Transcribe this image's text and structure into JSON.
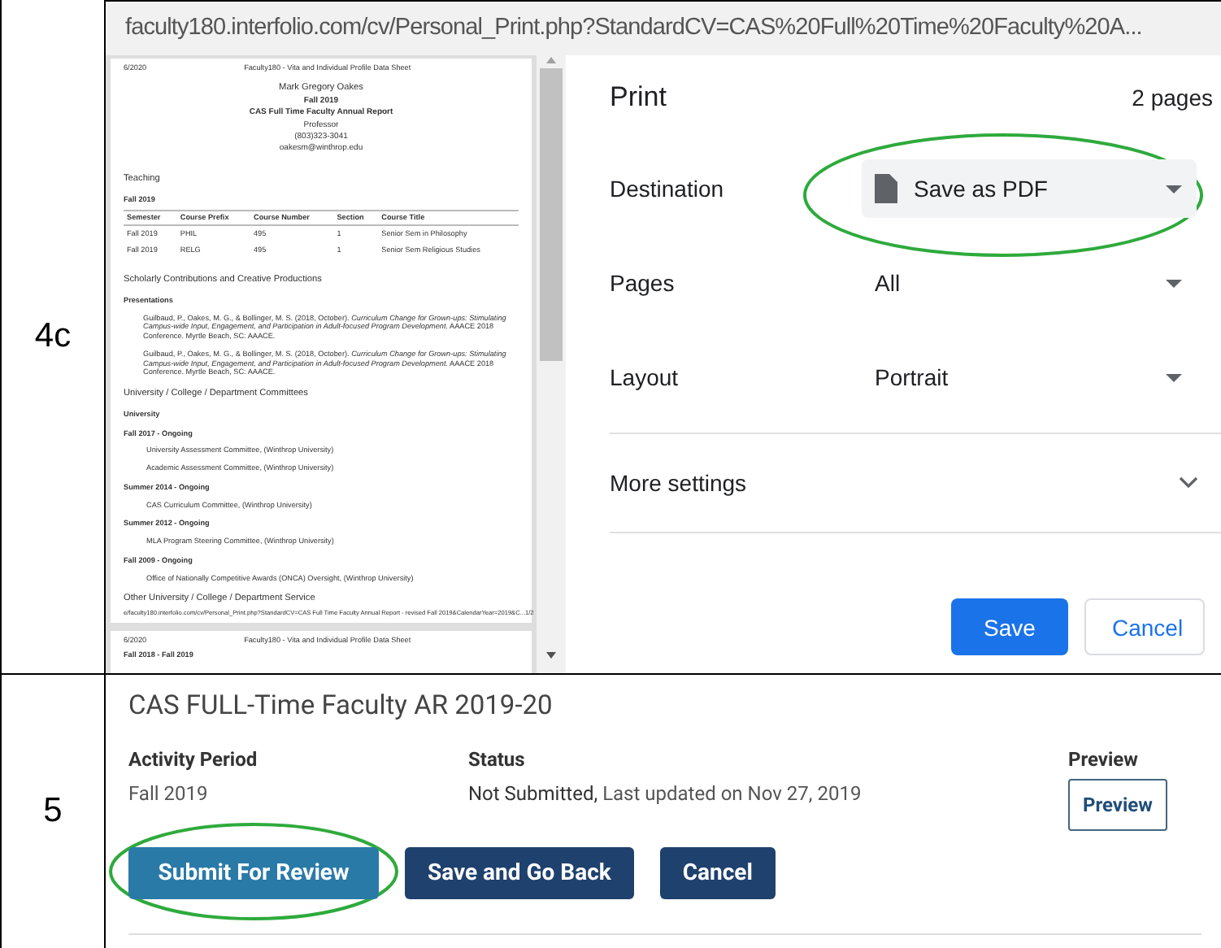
{
  "steps": [
    {
      "label": "4c",
      "kind": "print"
    },
    {
      "label": "5",
      "kind": "review"
    }
  ],
  "print_screen": {
    "url": "faculty180.interfolio.com/cv/Personal_Print.php?StandardCV=CAS%20Full%20Time%20Faculty%20A...",
    "preview": {
      "header_date": "6/2020",
      "header_title": "Faculty180 - Vita and Individual Profile Data Sheet",
      "identity": [
        "Mark Gregory Oakes",
        "Fall 2019",
        "CAS Full Time Faculty Annual Report",
        "Professor",
        "(803)323-3041",
        "oakesm@winthrop.edu"
      ],
      "teaching": {
        "heading": "Teaching",
        "term": "Fall 2019",
        "columns": [
          "Semester",
          "Course Prefix",
          "Course Number",
          "Section",
          "Course Title"
        ],
        "rows": [
          [
            "Fall 2019",
            "PHIL",
            "495",
            "1",
            "Senior Sem in Philosophy"
          ],
          [
            "Fall 2019",
            "RELG",
            "495",
            "1",
            "Senior Sem Religious Studies"
          ]
        ]
      },
      "scholarly": {
        "heading": "Scholarly Contributions and Creative Productions",
        "subheading": "Presentations",
        "citations": [
          "Guilbaud, P., Oakes, M. G., & Bollinger, M. S. (2018, October). *Curriculum Change for Grown-ups: Stimulating Campus-wide Input, Engagement, and Participation in Adult-focused Program Development.* AAACE 2018 Conference. Myrtle Beach, SC: AAACE.",
          "Guilbaud, P., Oakes, M. G., & Bollinger, M. S. (2018, October). *Curriculum Change for Grown-ups: Stimulating Campus-wide Input, Engagement, and Participation in Adult-focused Program Development.* AAACE 2018 Conference. Myrtle Beach, SC: AAACE."
        ]
      },
      "committees": {
        "heading": "University / College / Department Committees",
        "subheading": "University",
        "groups": [
          {
            "period": "Fall 2017 - Ongoing",
            "items": [
              "University Assessment Committee, (Winthrop University)",
              "Academic Assessment Committee, (Winthrop University)"
            ]
          },
          {
            "period": "Summer 2014 - Ongoing",
            "items": [
              "CAS Curriculum Committee, (Winthrop University)"
            ]
          },
          {
            "period": "Summer 2012 - Ongoing",
            "items": [
              "MLA Program Steering Committee, (Winthrop University)"
            ]
          },
          {
            "period": "Fall 2009 - Ongoing",
            "items": [
              "Office of Nationally Competitive Awards (ONCA) Oversight, (Winthrop University)"
            ]
          }
        ]
      },
      "next_heading": "Other University / College / Department Service",
      "footer_url": "e/faculty180.interfolio.com/cv/Personal_Print.php?StandardCV=CAS Full Time Faculty Annual Report - revised Fall 2019&CalendarYear=2019&C...",
      "footer_page": "1/2",
      "page2": {
        "header_date": "6/2020",
        "header_title": "Faculty180 - Vita and Individual Profile Data Sheet",
        "first_line": "Fall 2018 - Fall 2019"
      }
    },
    "dialog": {
      "title": "Print",
      "page_count": "2 pages",
      "settings": [
        {
          "label": "Destination",
          "value": "Save as PDF",
          "kind": "destination",
          "highlighted": true
        },
        {
          "label": "Pages",
          "value": "All",
          "kind": "select",
          "highlighted": false
        },
        {
          "label": "Layout",
          "value": "Portrait",
          "kind": "select",
          "highlighted": false
        }
      ],
      "more_settings": "More settings",
      "buttons": [
        {
          "label": "Save",
          "kind": "primary"
        },
        {
          "label": "Cancel",
          "kind": "secondary"
        }
      ]
    }
  },
  "review_screen": {
    "title": "CAS FULL-Time Faculty AR 2019-20",
    "activity_label": "Activity Period",
    "activity_value": "Fall 2019",
    "status_label": "Status",
    "status_value": "Not Submitted,",
    "status_detail": "Last updated on Nov 27, 2019",
    "preview_label": "Preview",
    "preview_button": "Preview",
    "buttons": [
      {
        "label": "Submit For Review",
        "kind": "submit",
        "highlighted": true
      },
      {
        "label": "Save and Go Back",
        "kind": "dark",
        "highlighted": false
      },
      {
        "label": "Cancel",
        "kind": "dark",
        "highlighted": false
      }
    ]
  }
}
